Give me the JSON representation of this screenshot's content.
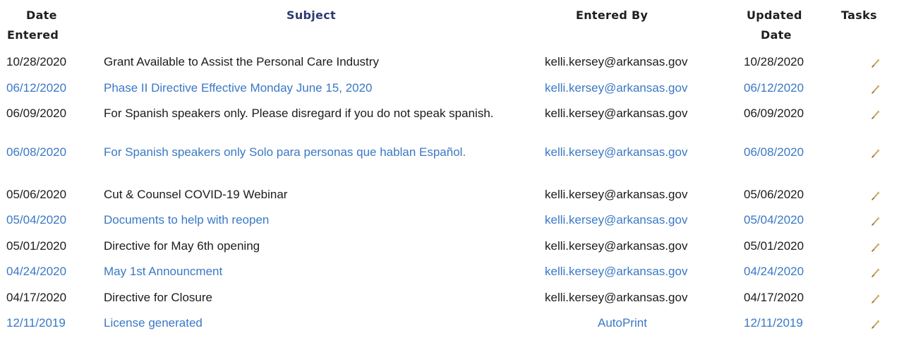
{
  "header": {
    "date_entered_line1": "Date",
    "date_entered_line2": "Entered",
    "subject": "Subject",
    "entered_by": "Entered By",
    "updated_date_line1": "Updated",
    "updated_date_line2": "Date",
    "tasks": "Tasks"
  },
  "rows": [
    {
      "date_entered": "10/28/2020",
      "subject": "Grant Available to Assist the Personal Care Industry",
      "entered_by": "kelli.kersey@arkansas.gov",
      "updated_date": "10/28/2020",
      "task_icon": "pencil-icon"
    },
    {
      "date_entered": "06/12/2020",
      "subject": "Phase II Directive Effective Monday June 15, 2020",
      "entered_by": "kelli.kersey@arkansas.gov",
      "updated_date": "06/12/2020",
      "task_icon": "pencil-icon"
    },
    {
      "date_entered": "06/09/2020",
      "subject": "For Spanish speakers only. Please disregard if you do not speak spanish.",
      "entered_by": "kelli.kersey@arkansas.gov",
      "updated_date": "06/09/2020",
      "task_icon": "pencil-icon"
    },
    {
      "date_entered": "06/08/2020",
      "subject": "For Spanish speakers only  Solo para personas que hablan Español.",
      "entered_by": "kelli.kersey@arkansas.gov",
      "updated_date": "06/08/2020",
      "task_icon": "pencil-icon"
    },
    {
      "date_entered": "05/06/2020",
      "subject": "Cut & Counsel COVID-19 Webinar",
      "entered_by": "kelli.kersey@arkansas.gov",
      "updated_date": "05/06/2020",
      "task_icon": "pencil-icon"
    },
    {
      "date_entered": "05/04/2020",
      "subject": "Documents to help with reopen",
      "entered_by": "kelli.kersey@arkansas.gov",
      "updated_date": "05/04/2020",
      "task_icon": "pencil-icon"
    },
    {
      "date_entered": "05/01/2020",
      "subject": "Directive for May 6th opening",
      "entered_by": "kelli.kersey@arkansas.gov",
      "updated_date": "05/01/2020",
      "task_icon": "pencil-icon"
    },
    {
      "date_entered": "04/24/2020",
      "subject": "May 1st Announcment",
      "entered_by": "kelli.kersey@arkansas.gov",
      "updated_date": "04/24/2020",
      "task_icon": "pencil-icon"
    },
    {
      "date_entered": "04/17/2020",
      "subject": "Directive for Closure",
      "entered_by": "kelli.kersey@arkansas.gov",
      "updated_date": "04/17/2020",
      "task_icon": "pencil-icon"
    },
    {
      "date_entered": "12/11/2019",
      "subject": "License generated",
      "entered_by": "AutoPrint",
      "updated_date": "12/11/2019",
      "task_icon": "pencil-icon"
    }
  ],
  "colors": {
    "text_dark": "#1c1c1c",
    "alt_row_blue": "#3a78c5",
    "subject_header": "#2d3a72",
    "pencil_icon": "#c8a25a"
  }
}
